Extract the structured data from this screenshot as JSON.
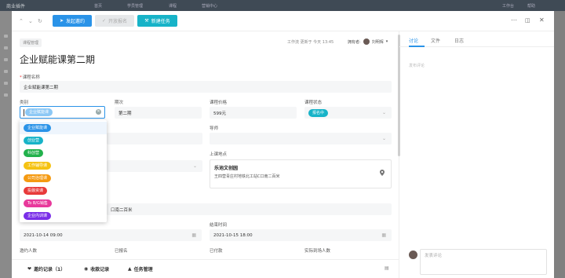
{
  "background": {
    "brand": "商业插件",
    "nav": [
      "首页",
      "学员管理",
      "课程",
      "营销中心"
    ],
    "right": [
      "工作台",
      "帮助"
    ]
  },
  "toolbar": {
    "invite_label": "发起邀约",
    "signup_label": "开放报名",
    "new_task_label": "新建任务"
  },
  "header": {
    "tag": "课程管理",
    "meta": "工作流 更新于 今天 13:45",
    "owner_label": "拥有者:",
    "owner_name": "刘明辉",
    "title": "企业赋能课第二期"
  },
  "form": {
    "course_name": {
      "label": "课程名称",
      "value": "企业赋能课第二期"
    },
    "category": {
      "label": "类别",
      "selected": "企业赋能课"
    },
    "session": {
      "label": "期次",
      "value": "第二期"
    },
    "price": {
      "label": "课程价格",
      "value": "599元"
    },
    "status": {
      "label": "课程状态",
      "value": "报名中"
    },
    "mentor": {
      "label": "导师"
    },
    "venue": {
      "label": "上课地点",
      "name": "乐池文创园",
      "address": "王四营青庄村地铁北工站C口南二百米"
    },
    "address_value": "口南二百米",
    "end_time": {
      "label": "结束时间",
      "value": "2021-10-15 18:00"
    },
    "start_time": {
      "value": "2021-10-14 09:00"
    },
    "invited": {
      "label": "邀约人数"
    },
    "signed": {
      "label": "已报名"
    },
    "paid": {
      "label": "已付款"
    },
    "attended": {
      "label": "实际到场人数"
    }
  },
  "dropdown": {
    "options": [
      {
        "label": "企业赋能课",
        "color": "#2a93e8"
      },
      {
        "label": "创业营",
        "color": "#17b3c8"
      },
      {
        "label": "科创营",
        "color": "#22b14c"
      },
      {
        "label": "工作辅导课",
        "color": "#f5c211"
      },
      {
        "label": "公司治理课",
        "color": "#f59a11"
      },
      {
        "label": "投融资课",
        "color": "#e83a3a"
      },
      {
        "label": "To B/G销售",
        "color": "#e8399b"
      },
      {
        "label": "企业内训课",
        "color": "#7a2ee8"
      }
    ]
  },
  "bottom_tabs": {
    "invites": "邀约记录（1）",
    "payments": "收款记录",
    "tasks": "任务管理"
  },
  "right_panel": {
    "tabs": [
      "讨论",
      "文件",
      "日志"
    ],
    "empty_text": "发布评论",
    "comment_placeholder": "发表评论"
  },
  "colors": {
    "primary": "#2a93e8",
    "teal": "#17b3c8"
  }
}
